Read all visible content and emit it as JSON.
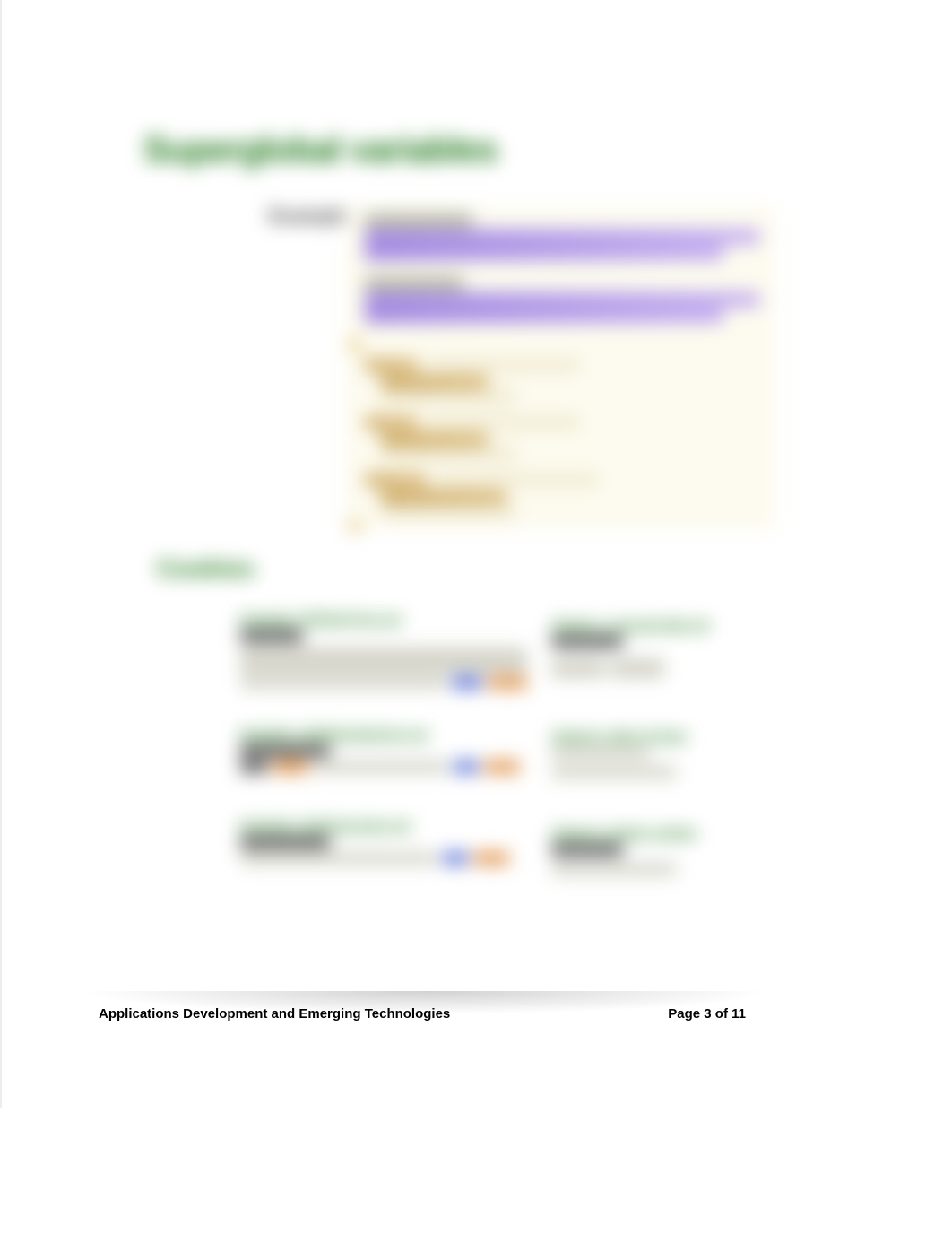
{
  "headings": {
    "h1": "Superglobal variables",
    "h2": "Cookies",
    "example_label": "Example"
  },
  "examples": {
    "e1": "Example: PHPSelf form set",
    "e2": "Example: GetRedundancies set",
    "e3": "Example: GetDestructive set",
    "o1": "Output 1: unusual date set",
    "o2": "Output 2: after 10 days",
    "o3": "Output 3: delete cookies"
  },
  "footer": {
    "left": "Applications Development and Emerging Technologies",
    "right": "Page 3 of 11"
  }
}
